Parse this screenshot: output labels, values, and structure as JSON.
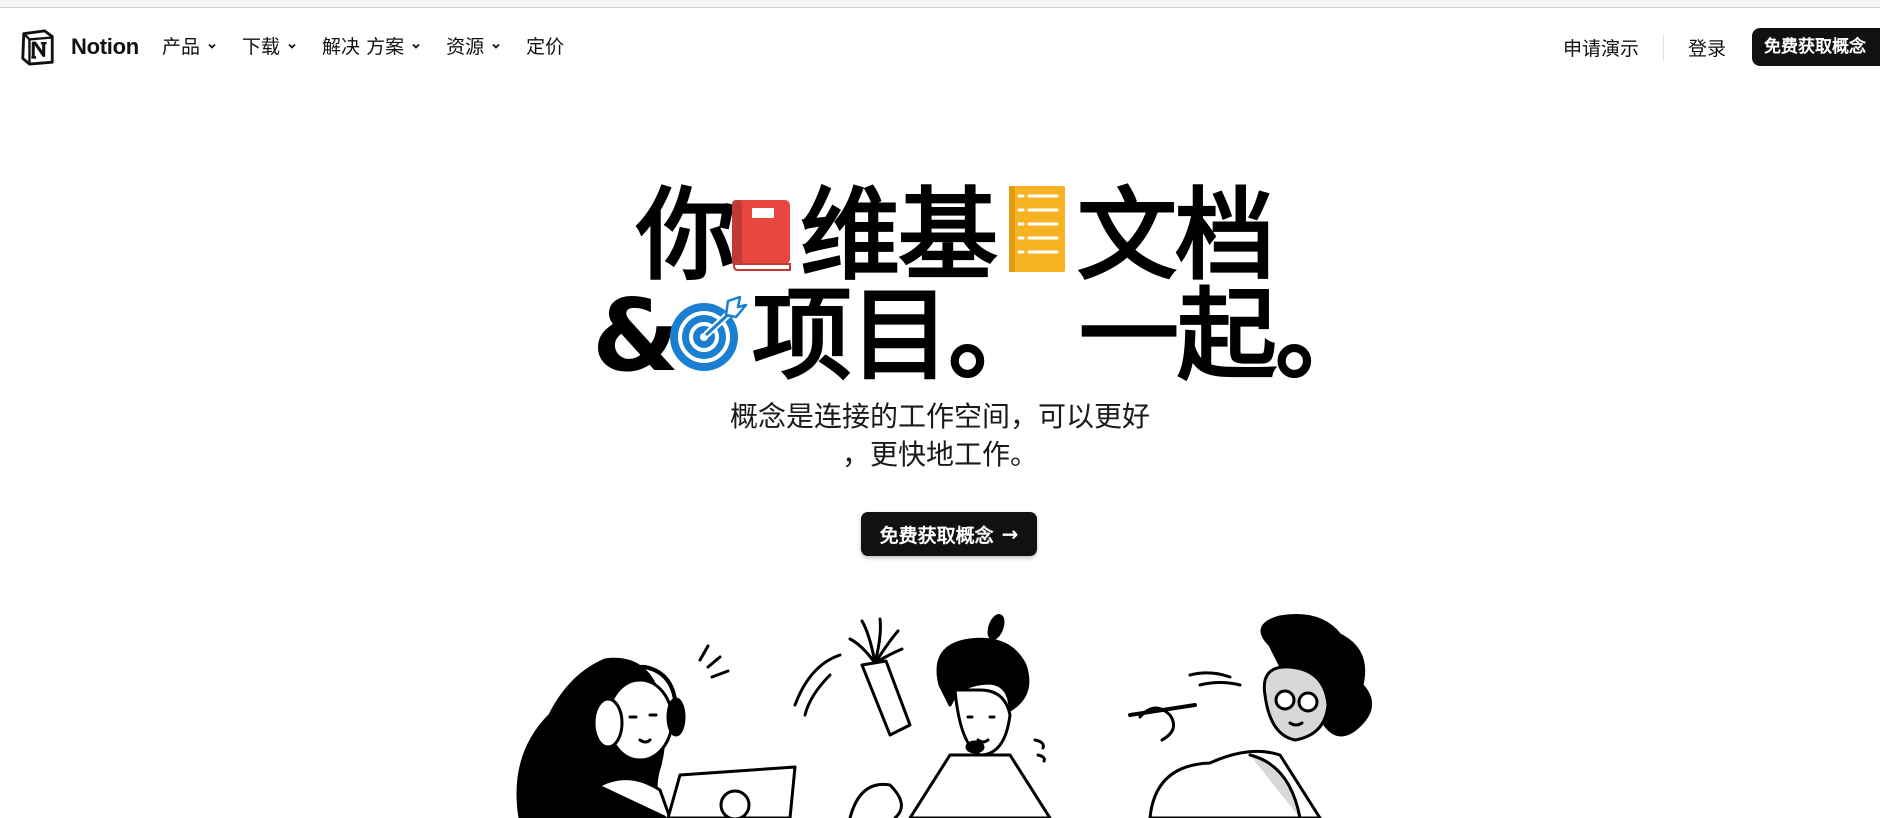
{
  "nav": {
    "brand": "Notion",
    "menu": [
      {
        "label": "产品",
        "has_dropdown": true
      },
      {
        "label": "下载",
        "has_dropdown": true
      },
      {
        "label": "解决 方案",
        "has_dropdown": true
      },
      {
        "label": "资源",
        "has_dropdown": true
      },
      {
        "label": "定价",
        "has_dropdown": false
      }
    ],
    "demo_label": "申请演示",
    "login_label": "登录",
    "cta_label": "免费获取概念"
  },
  "hero": {
    "line1": [
      "你",
      "维基",
      "文档"
    ],
    "line2": [
      "&",
      "项目。 一起。"
    ],
    "emojis": [
      "book-icon",
      "notepad-icon",
      "target-icon"
    ],
    "subtitle_line1": "概念是连接的工作空间，可以更好",
    "subtitle_line2": "，更快地工作。",
    "cta_label": "免费获取概念",
    "cta_arrow": "→"
  },
  "colors": {
    "book": "#e8473f",
    "notepad": "#f5b324",
    "target": "#1a7fd1",
    "cta_bg": "#111111"
  }
}
